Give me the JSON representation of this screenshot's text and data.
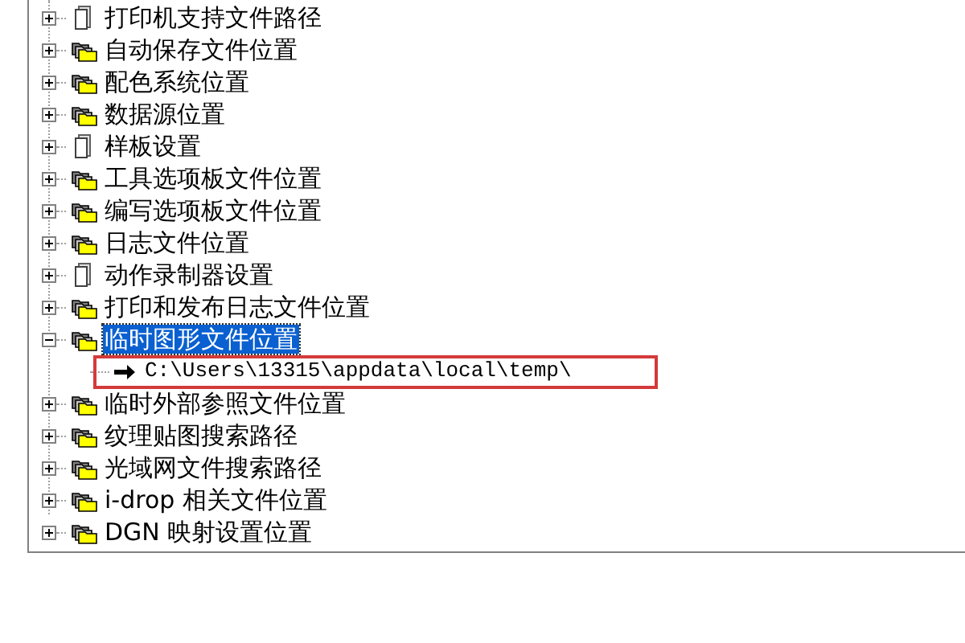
{
  "tree": {
    "items": [
      {
        "label": "打印机支持文件路径",
        "kind": "document",
        "expanded": false,
        "selected": false
      },
      {
        "label": "自动保存文件位置",
        "kind": "folder",
        "expanded": false,
        "selected": false
      },
      {
        "label": "配色系统位置",
        "kind": "folder",
        "expanded": false,
        "selected": false
      },
      {
        "label": "数据源位置",
        "kind": "folder",
        "expanded": false,
        "selected": false
      },
      {
        "label": "样板设置",
        "kind": "document",
        "expanded": false,
        "selected": false
      },
      {
        "label": "工具选项板文件位置",
        "kind": "folder",
        "expanded": false,
        "selected": false
      },
      {
        "label": "编写选项板文件位置",
        "kind": "folder",
        "expanded": false,
        "selected": false
      },
      {
        "label": "日志文件位置",
        "kind": "folder",
        "expanded": false,
        "selected": false
      },
      {
        "label": "动作录制器设置",
        "kind": "document",
        "expanded": false,
        "selected": false
      },
      {
        "label": "打印和发布日志文件位置",
        "kind": "folder",
        "expanded": false,
        "selected": false
      },
      {
        "label": "临时图形文件位置",
        "kind": "folder",
        "expanded": true,
        "selected": true,
        "children": [
          {
            "label": "C:\\Users\\13315\\appdata\\local\\temp\\",
            "kind": "path",
            "annotated": true
          }
        ]
      },
      {
        "label": "临时外部参照文件位置",
        "kind": "folder",
        "expanded": false,
        "selected": false
      },
      {
        "label": "纹理贴图搜索路径",
        "kind": "folder",
        "expanded": false,
        "selected": false
      },
      {
        "label": "光域网文件搜索路径",
        "kind": "folder",
        "expanded": false,
        "selected": false
      },
      {
        "label": "i-drop 相关文件位置",
        "kind": "folder",
        "expanded": false,
        "selected": false
      },
      {
        "label": "DGN 映射设置位置",
        "kind": "folder",
        "expanded": false,
        "selected": false
      }
    ]
  }
}
